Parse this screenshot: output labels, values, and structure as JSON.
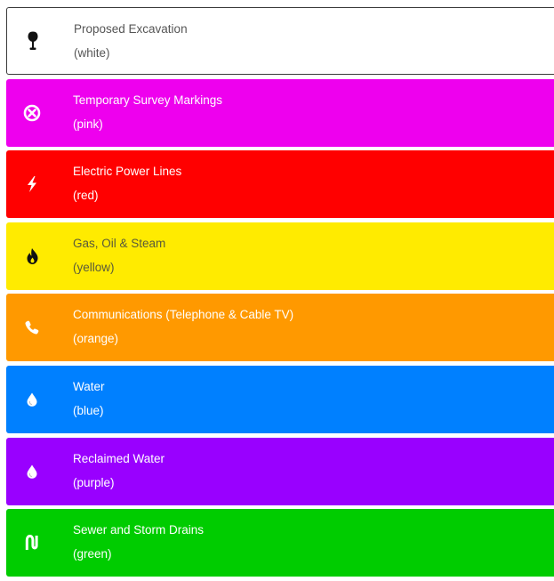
{
  "legend": [
    {
      "title": "Proposed Excavation",
      "subtitle": "(white)",
      "bg": "#ffffff",
      "text_color": "#555555",
      "icon": "shovel-icon",
      "icon_color": "#111111",
      "key": "white"
    },
    {
      "title": "Temporary Survey Markings",
      "subtitle": "(pink)",
      "bg": "#ee00ee",
      "text_color": "#ffffff",
      "icon": "circle-x-icon",
      "icon_color": "#ffffff",
      "key": "pink"
    },
    {
      "title": "Electric Power Lines",
      "subtitle": "(red)",
      "bg": "#ff0000",
      "text_color": "#ffffff",
      "icon": "lightning-bolt-icon",
      "icon_color": "#ffffff",
      "key": "red"
    },
    {
      "title": "Gas, Oil & Steam",
      "subtitle": "(yellow)",
      "bg": "#ffeb00",
      "text_color": "#5a5a3a",
      "icon": "flame-icon",
      "icon_color": "#111111",
      "key": "yellow"
    },
    {
      "title": "Communications (Telephone & Cable TV)",
      "subtitle": "(orange)",
      "bg": "#ff9900",
      "text_color": "#ffffff",
      "icon": "phone-icon",
      "icon_color": "#ffffff",
      "key": "orange"
    },
    {
      "title": "Water",
      "subtitle": "(blue)",
      "bg": "#0080ff",
      "text_color": "#ffffff",
      "icon": "water-drop-icon",
      "icon_color": "#ffffff",
      "key": "blue"
    },
    {
      "title": "Reclaimed Water",
      "subtitle": "(purple)",
      "bg": "#9900ff",
      "text_color": "#ffffff",
      "icon": "water-drop-icon",
      "icon_color": "#ffffff",
      "key": "purple"
    },
    {
      "title": "Sewer and Storm Drains",
      "subtitle": "(green)",
      "bg": "#00cc00",
      "text_color": "#ffffff",
      "icon": "sewer-pipe-icon",
      "icon_color": "#ffffff",
      "key": "green"
    }
  ]
}
